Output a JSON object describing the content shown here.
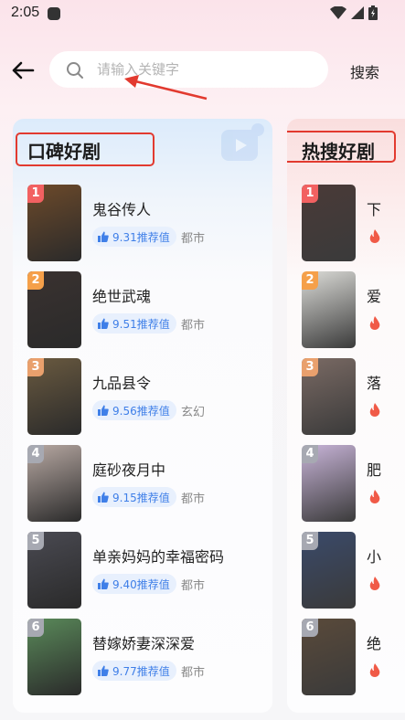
{
  "status": {
    "time": "2:05"
  },
  "search": {
    "placeholder": "请输入关键字",
    "button_label": "搜索"
  },
  "accent_colors": {
    "search_blue": "#3f7fe8",
    "hot_red": "#f05a47",
    "annotation_red": "#e23a2f"
  },
  "left_panel": {
    "title": "口碑好剧",
    "items": [
      {
        "rank": "1",
        "title": "鬼谷传人",
        "score": "9.31推荐值",
        "genre": "都市",
        "rank_color": "#f26161",
        "poster_color": "#6d4a2a"
      },
      {
        "rank": "2",
        "title": "绝世武魂",
        "score": "9.51推荐值",
        "genre": "都市",
        "rank_color": "#f5a04a",
        "poster_color": "#3a3230"
      },
      {
        "rank": "3",
        "title": "九品县令",
        "score": "9.56推荐值",
        "genre": "玄幻",
        "rank_color": "#e9a06d",
        "poster_color": "#6a5a40"
      },
      {
        "rank": "4",
        "title": "庭砂夜月中",
        "score": "9.15推荐值",
        "genre": "都市",
        "rank_color": "#a7a9b2",
        "poster_color": "#b8a9a3"
      },
      {
        "rank": "5",
        "title": "单亲妈妈的幸福密码",
        "score": "9.40推荐值",
        "genre": "都市",
        "rank_color": "#a7a9b2",
        "poster_color": "#4a4a52"
      },
      {
        "rank": "6",
        "title": "替嫁娇妻深深爱",
        "score": "9.77推荐值",
        "genre": "都市",
        "rank_color": "#a7a9b2",
        "poster_color": "#5a8a5a"
      }
    ]
  },
  "right_panel": {
    "title": "热搜好剧",
    "items": [
      {
        "rank": "1",
        "title": "下",
        "rank_color": "#f26161",
        "poster_color": "#4a3a38"
      },
      {
        "rank": "2",
        "title": "爱",
        "rank_color": "#f5a04a",
        "poster_color": "#dcdcd8"
      },
      {
        "rank": "3",
        "title": "落",
        "rank_color": "#e9a06d",
        "poster_color": "#7a6a64"
      },
      {
        "rank": "4",
        "title": "肥",
        "rank_color": "#a7a9b2",
        "poster_color": "#c8b4d8"
      },
      {
        "rank": "5",
        "title": "小",
        "rank_color": "#a7a9b2",
        "poster_color": "#3a4a6a"
      },
      {
        "rank": "6",
        "title": "绝",
        "rank_color": "#a7a9b2",
        "poster_color": "#5a4a3a"
      }
    ]
  }
}
